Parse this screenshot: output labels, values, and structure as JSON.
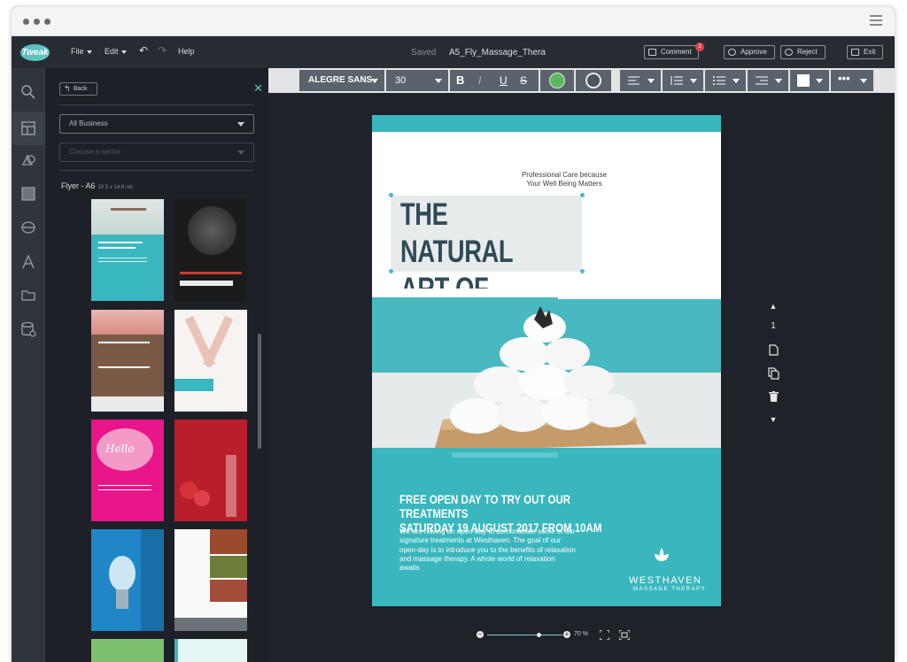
{
  "app": {
    "logo": "Tweak",
    "menu": [
      {
        "label": "File"
      },
      {
        "label": "Edit"
      },
      {
        "label": "Help"
      }
    ],
    "saved_status": "Saved",
    "document_name": "A5_Fly_Massage_Thera",
    "comment_label": "Comment",
    "comment_count": "2",
    "approve_label": "Approve",
    "reject_label": "Reject",
    "exit_label": "Exit"
  },
  "sidebar": {
    "back_label": "Back",
    "filter_business": "All Business",
    "sector_placeholder": "Choose a sector",
    "section_title": "Flyer - A6",
    "section_size": "10.5 x 14.8 cm",
    "rail_icons": [
      "search-icon",
      "templates-icon",
      "shapes-icon",
      "background-icon",
      "layers-icon",
      "text-icon",
      "folder-icon",
      "database-icon"
    ]
  },
  "toolbar": {
    "font_name": "ALEGRE SANS",
    "font_size": "30",
    "bold": "B",
    "italic": "I",
    "underline": "U",
    "strikethrough": "S",
    "colors": {
      "text_color": "#5cb85c",
      "outline_color": "#5a636b",
      "fill": "#ffffff"
    }
  },
  "flyer": {
    "tagline_1": "Professional Care because",
    "tagline_2": "Your Well Being Matters",
    "headline_1": "THE NATURAL",
    "headline_2": "ART OF HEALING",
    "event_1": "FREE OPEN DAY TO TRY OUT OUR TREATMENTS",
    "event_2": "SATURDAY 19 AUGUST 2017 FROM 10AM",
    "body": "We are having an open-day to demonstrate some of our signature treatments at Westhaven. The goal of our open-day is to introduce you to the benefits of relaxation and massage therapy. A whole world of relaxation awaits",
    "brand_name": "WESTHAVEN",
    "brand_sub": "MASSAGE THERAPY",
    "teal": "#39b7bd",
    "headline_color": "#2f4b57"
  },
  "page_controls": {
    "page_number": "1"
  },
  "zoom": {
    "level": "70 %",
    "slider_value": 0.68
  }
}
